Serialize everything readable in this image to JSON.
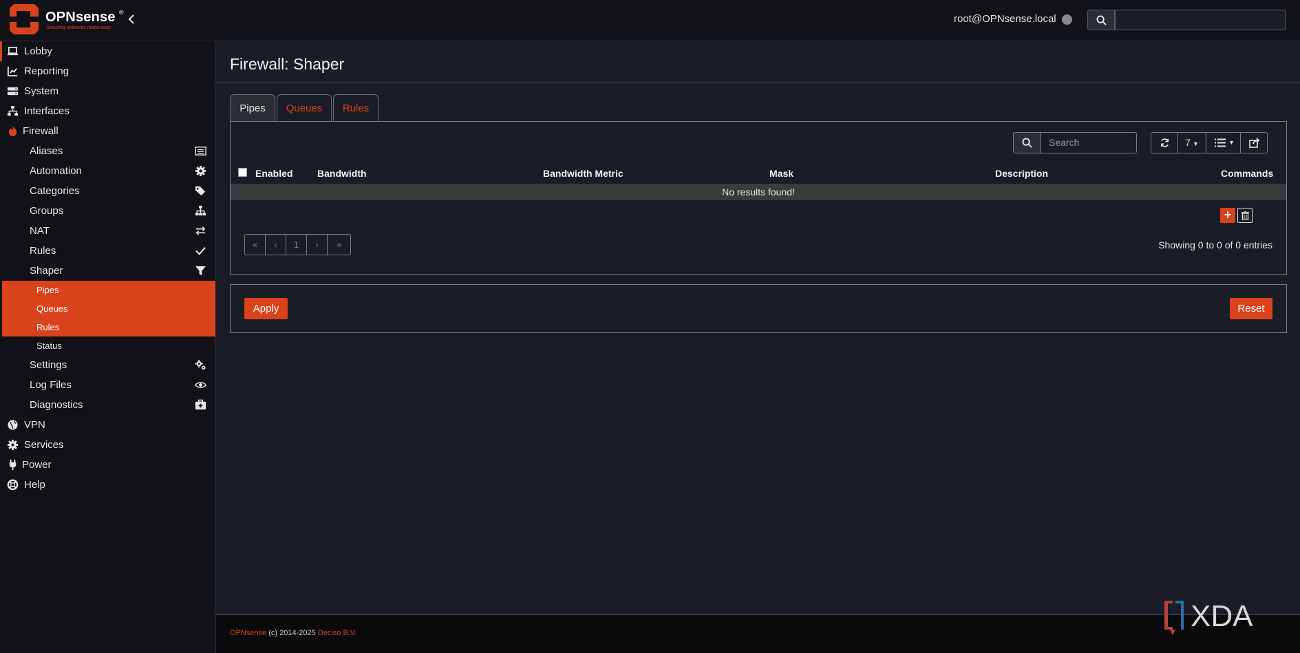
{
  "brand": {
    "name": "OPNsense",
    "tagline": "Securing networks made easy",
    "accent": "#d9431b"
  },
  "header": {
    "user": "root@OPNsense.local",
    "search_value": ""
  },
  "sidebar": {
    "items": [
      {
        "label": "Lobby",
        "icon": "laptop-icon"
      },
      {
        "label": "Reporting",
        "icon": "chart-icon"
      },
      {
        "label": "System",
        "icon": "server-icon"
      },
      {
        "label": "Interfaces",
        "icon": "network-icon"
      },
      {
        "label": "Firewall",
        "icon": "fire-icon"
      }
    ],
    "firewall_children": [
      {
        "label": "Aliases",
        "icon": "list-icon"
      },
      {
        "label": "Automation",
        "icon": "gear-icon"
      },
      {
        "label": "Categories",
        "icon": "tags-icon"
      },
      {
        "label": "Groups",
        "icon": "sitemap-icon"
      },
      {
        "label": "NAT",
        "icon": "exchange-icon"
      },
      {
        "label": "Rules",
        "icon": "check-icon"
      },
      {
        "label": "Shaper",
        "icon": "filter-icon"
      }
    ],
    "shaper_children": [
      {
        "label": "Pipes"
      },
      {
        "label": "Queues"
      },
      {
        "label": "Rules"
      },
      {
        "label": "Status"
      }
    ],
    "firewall_children_after": [
      {
        "label": "Settings",
        "icon": "gears-icon"
      },
      {
        "label": "Log Files",
        "icon": "eye-icon"
      },
      {
        "label": "Diagnostics",
        "icon": "medkit-icon"
      }
    ],
    "items_after": [
      {
        "label": "VPN",
        "icon": "globe-icon"
      },
      {
        "label": "Services",
        "icon": "cog-icon"
      },
      {
        "label": "Power",
        "icon": "plug-icon"
      },
      {
        "label": "Help",
        "icon": "lifebuoy-icon"
      }
    ]
  },
  "main": {
    "title": "Firewall: Shaper",
    "tabs": [
      "Pipes",
      "Queues",
      "Rules"
    ],
    "grid": {
      "search_placeholder": "Search",
      "page_size": "7",
      "columns": [
        "Enabled",
        "Bandwidth",
        "Bandwidth Metric",
        "Mask",
        "Description",
        "Commands"
      ],
      "empty_text": "No results found!",
      "pager": [
        "«",
        "‹",
        "1",
        "›",
        "»"
      ],
      "info": "Showing 0 to 0 of 0 entries"
    },
    "apply_label": "Apply",
    "reset_label": "Reset"
  },
  "footer": {
    "product": "OPNsense",
    "copyright": "(c) 2014-2025",
    "company": "Deciso B.V."
  },
  "watermark": "XDA"
}
